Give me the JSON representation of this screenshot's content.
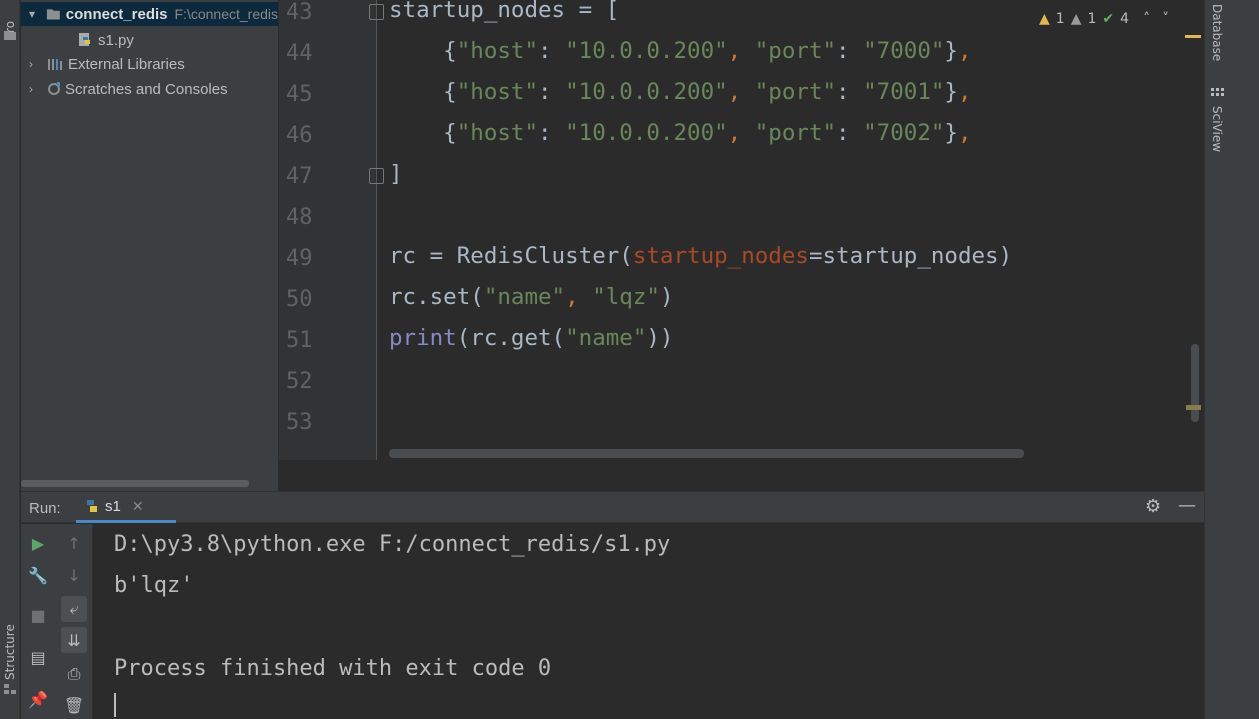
{
  "project_tab": {
    "label": "Pro"
  },
  "structure_tab": {
    "label": "Structure"
  },
  "right_tabs": {
    "database": "Database",
    "sciview": "SciView"
  },
  "project_tree": {
    "root": {
      "name": "connect_redis",
      "path": "F:\\connect_redis"
    },
    "file": "s1.py",
    "external": "External Libraries",
    "scratches": "Scratches and Consoles"
  },
  "editor": {
    "line_numbers": [
      "43",
      "44",
      "45",
      "46",
      "47",
      "48",
      "49",
      "50",
      "51",
      "52",
      "53"
    ],
    "code": {
      "l43_var": "startup_nodes",
      "l43_rest": " = [",
      "hosts": [
        {
          "host_key": "\"host\"",
          "host_val": "\"10.0.0.200\"",
          "port_key": "\"port\"",
          "port_val": "\"7000\""
        },
        {
          "host_key": "\"host\"",
          "host_val": "\"10.0.0.200\"",
          "port_key": "\"port\"",
          "port_val": "\"7001\""
        },
        {
          "host_key": "\"host\"",
          "host_val": "\"10.0.0.200\"",
          "port_key": "\"port\"",
          "port_val": "\"7002\""
        }
      ],
      "l47": "]",
      "l49_a": "rc = RedisCluster(",
      "l49_kw": "startup_nodes",
      "l49_b": "=startup_nodes)",
      "l50_a": "rc.set(",
      "l50_s1": "\"name\"",
      "l50_s2": "\"lqz\"",
      "l50_b": ")",
      "l51_fn": "print",
      "l51_a": "(rc.get(",
      "l51_s": "\"name\"",
      "l51_b": "))"
    },
    "inspections": {
      "warnings": "1",
      "weak_warnings": "1",
      "typos": "4"
    }
  },
  "run": {
    "label": "Run:",
    "tab": "s1",
    "console": [
      "D:\\py3.8\\python.exe F:/connect_redis/s1.py",
      "b'lqz'",
      "",
      "Process finished with exit code 0"
    ]
  },
  "colors": {
    "keyword_arg": "#aa4926",
    "string": "#6a8759",
    "builtin": "#8888c6"
  }
}
